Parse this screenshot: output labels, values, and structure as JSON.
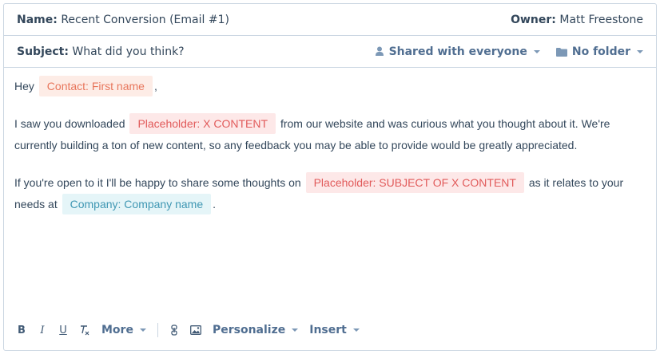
{
  "header": {
    "name_label": "Name:",
    "name_value": "Recent Conversion (Email #1)",
    "owner_label": "Owner:",
    "owner_value": "Matt Freestone"
  },
  "subject": {
    "label": "Subject:",
    "value": "What did you think?",
    "shared_label": "Shared with everyone",
    "folder_label": "No folder"
  },
  "body": {
    "p1_start": "Hey",
    "p1_token": "Contact: First name",
    "p1_end": ",",
    "p2_start": "I saw you downloaded",
    "p2_token": "Placeholder: X CONTENT",
    "p2_end": "from our website and was curious what you thought about it. We're currently building a ton of new content, so any feedback you may be able to provide would be greatly appreciated.",
    "p3_start": "If you're open to it I'll be happy to share some thoughts on",
    "p3_token1": "Placeholder: SUBJECT OF X CONTENT",
    "p3_mid": "as it relates to your needs at",
    "p3_token2": "Company: Company name",
    "p3_end": "."
  },
  "toolbar": {
    "bold": "B",
    "italic": "I",
    "underline": "U",
    "clear": "Tx",
    "more": "More",
    "personalize": "Personalize",
    "insert": "Insert"
  },
  "colors": {
    "accent": "#506e91",
    "border": "#cbd6e2",
    "token_red_bg": "#fde8e8",
    "token_teal_bg": "#e5f5f8"
  }
}
